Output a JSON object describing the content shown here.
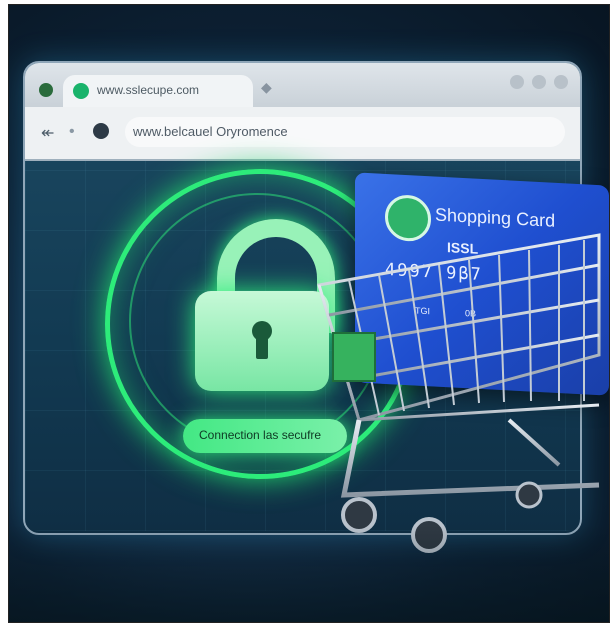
{
  "browser": {
    "tab_url": "www.sslecupe.com",
    "address_text": "www.belcauel Oryromence",
    "tab_icon": "green-circle-icon",
    "nav_icons": [
      "back-arrow-icon",
      "forward-dot-icon",
      "site-info-icon"
    ]
  },
  "security": {
    "status_text": "Connection las secufre",
    "lock_icon": "padlock-icon"
  },
  "card": {
    "title": "Shopping Card",
    "subtitle": "ISSL",
    "number": "4997  9β7",
    "small_left": "TGI",
    "small_right": "0B"
  },
  "colors": {
    "accent_green": "#2dec7a",
    "card_blue": "#1f4fd0",
    "background_navy": "#0d2236"
  }
}
